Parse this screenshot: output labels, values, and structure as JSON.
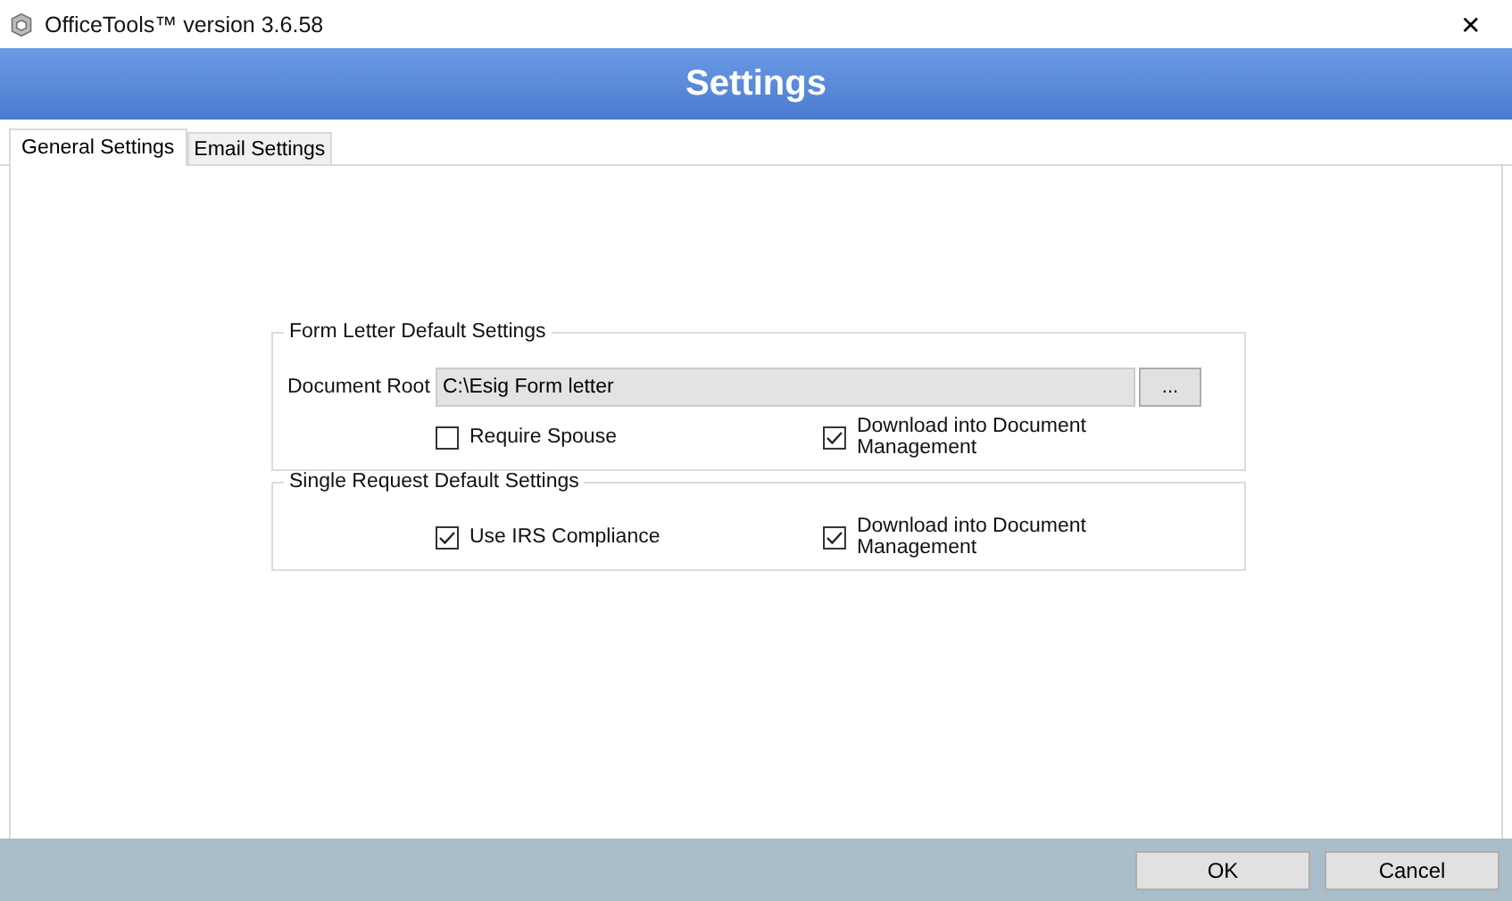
{
  "window": {
    "title": "OfficeTools™ version 3.6.58",
    "close": "✕"
  },
  "header": {
    "title": "Settings"
  },
  "tabs": [
    {
      "label": "General Settings",
      "selected": true
    },
    {
      "label": "Email Settings",
      "selected": false
    }
  ],
  "groups": [
    {
      "title": "Form Letter Default Settings",
      "field": {
        "label": "Document Root",
        "value": "C:\\Esig Form letter",
        "browse": "..."
      },
      "checkboxes": [
        {
          "label": "Require Spouse",
          "checked": false
        },
        {
          "label": "Download into Document Management",
          "checked": true
        }
      ]
    },
    {
      "title": "Single Request Default Settings",
      "checkboxes": [
        {
          "label": "Use IRS Compliance",
          "checked": true
        },
        {
          "label": "Download into Document Management",
          "checked": true
        }
      ]
    }
  ],
  "buttons": [
    "OK",
    "Cancel"
  ]
}
